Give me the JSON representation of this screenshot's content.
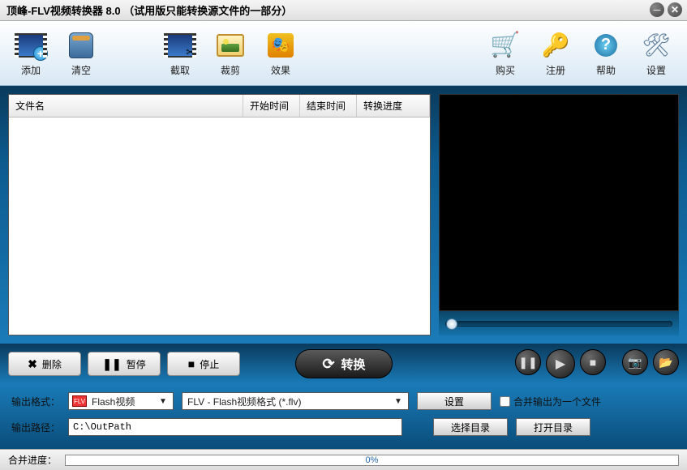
{
  "title": "顶峰-FLV视频转换器 8.0 （试用版只能转换源文件的一部分）",
  "toolbar": {
    "left": [
      {
        "id": "add",
        "label": "添加"
      },
      {
        "id": "clear",
        "label": "清空"
      },
      {
        "id": "capture",
        "label": "截取"
      },
      {
        "id": "crop",
        "label": "裁剪"
      },
      {
        "id": "effect",
        "label": "效果"
      }
    ],
    "right": [
      {
        "id": "buy",
        "label": "购买"
      },
      {
        "id": "register",
        "label": "注册"
      },
      {
        "id": "help",
        "label": "帮助"
      },
      {
        "id": "settings",
        "label": "设置"
      }
    ]
  },
  "columns": {
    "name": "文件名",
    "start": "开始时间",
    "end": "结束时间",
    "progress": "转换进度"
  },
  "actions": {
    "delete": "删除",
    "pause": "暂停",
    "stop": "停止",
    "convert": "转换"
  },
  "output": {
    "format_label": "输出格式：",
    "format_short": "Flash视频",
    "format_long": "FLV - Flash视频格式 (*.flv)",
    "settings_btn": "设置",
    "merge_label": "合并输出为一个文件",
    "path_label": "输出路径：",
    "path_value": "C:\\OutPath",
    "choose_dir": "选择目录",
    "open_dir": "打开目录"
  },
  "footer": {
    "label": "合并进度：",
    "percent": "0%"
  }
}
